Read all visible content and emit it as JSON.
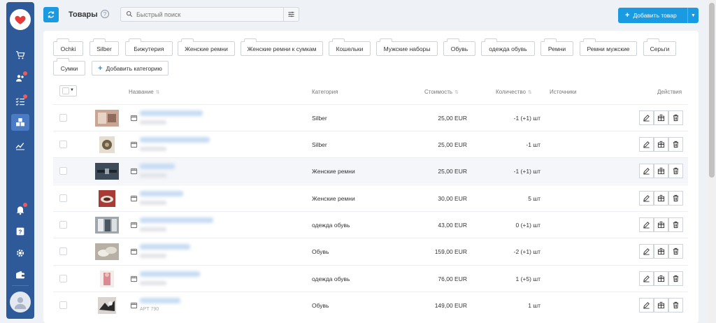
{
  "colors": {
    "primary": "#1a9ae0",
    "sidebar": "#2e5a9a",
    "badge": "#f05a5a"
  },
  "sidebar": {
    "items": [
      {
        "name": "cart-icon"
      },
      {
        "name": "users-icon",
        "badge": true
      },
      {
        "name": "tasks-icon",
        "badge": true
      },
      {
        "name": "products-icon",
        "active": true
      },
      {
        "name": "analytics-icon"
      },
      {
        "name": "bell-icon",
        "badge": true
      },
      {
        "name": "help-icon"
      },
      {
        "name": "gear-icon"
      },
      {
        "name": "wallet-icon"
      }
    ]
  },
  "header": {
    "title": "Товары",
    "help": "?",
    "search_placeholder": "Быстрый поиск",
    "add_product": "Добавить товар"
  },
  "categories": [
    "Ochki",
    "Silber",
    "Бижутерия",
    "Женские ремни",
    "Женские ремни к сумкам",
    "Кошельки",
    "Мужские наборы",
    "Обувь",
    "одежда обувь",
    "Ремни",
    "Ремни мужские",
    "Серьги",
    "Сумки"
  ],
  "add_category": "Добавить категорию",
  "table": {
    "columns": {
      "name": "Название",
      "category": "Категория",
      "cost": "Стоимость",
      "quantity": "Количество",
      "sources": "Источники",
      "actions": "Действия"
    },
    "rows": [
      {
        "category": "Silber",
        "price": "25,00 EUR",
        "qty": "-1 (+1) шт",
        "sku": ""
      },
      {
        "category": "Silber",
        "price": "25,00 EUR",
        "qty": "-1 шт",
        "sku": ""
      },
      {
        "category": "Женские ремни",
        "price": "25,00 EUR",
        "qty": "-1 (+1) шт",
        "sku": ""
      },
      {
        "category": "Женские ремни",
        "price": "30,00 EUR",
        "qty": "5 шт",
        "sku": ""
      },
      {
        "category": "одежда обувь",
        "price": "43,00 EUR",
        "qty": "0 (+1) шт",
        "sku": ""
      },
      {
        "category": "Обувь",
        "price": "159,00 EUR",
        "qty": "-2 (+1) шт",
        "sku": ""
      },
      {
        "category": "одежда обувь",
        "price": "76,00 EUR",
        "qty": "1 (+5) шт",
        "sku": ""
      },
      {
        "category": "Обувь",
        "price": "149,00 EUR",
        "qty": "1 шт",
        "sku": "APT 790"
      }
    ]
  }
}
